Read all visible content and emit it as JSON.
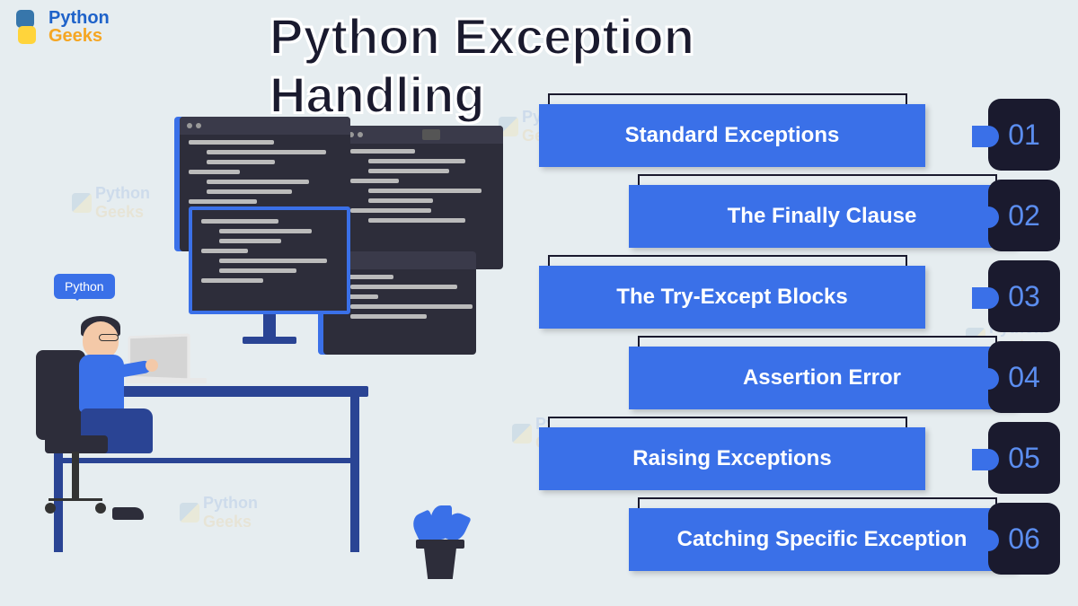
{
  "logo": {
    "python": "Python",
    "geeks": "Geeks"
  },
  "title": "Python Exception Handling",
  "speech_bubble": "Python",
  "topics": [
    {
      "label": "Standard Exceptions",
      "num": "01",
      "offset": false
    },
    {
      "label": "The Finally Clause",
      "num": "02",
      "offset": true
    },
    {
      "label": "The Try-Except Blocks",
      "num": "03",
      "offset": false
    },
    {
      "label": "Assertion Error",
      "num": "04",
      "offset": true
    },
    {
      "label": "Raising Exceptions",
      "num": "05",
      "offset": false
    },
    {
      "label": "Catching Specific Exception",
      "num": "06",
      "offset": true
    }
  ],
  "watermark": {
    "python": "Python",
    "geeks": "Geeks"
  }
}
